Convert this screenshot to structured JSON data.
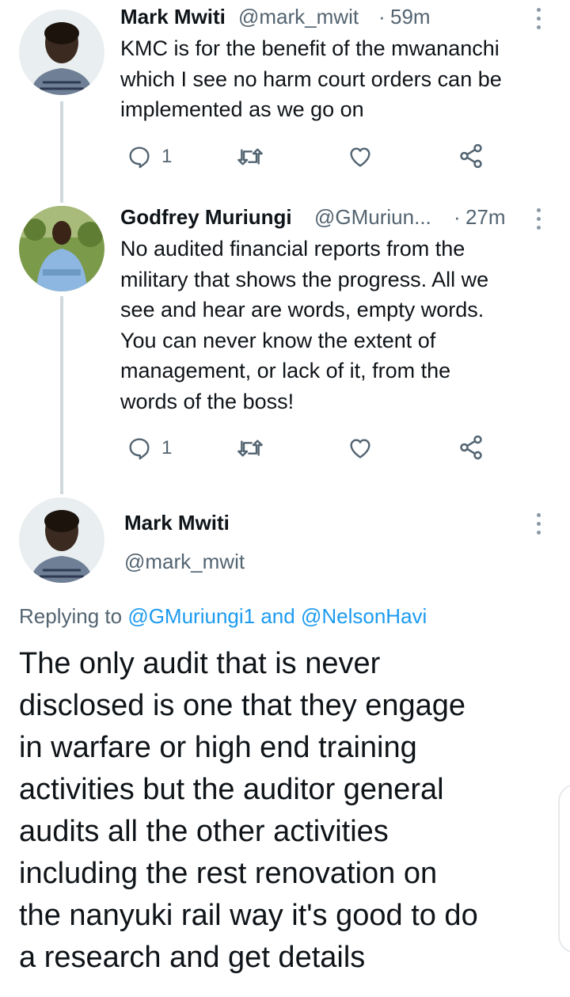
{
  "tweets": [
    {
      "name": "Mark Mwiti",
      "handle": "@mark_mwit",
      "separator": "·",
      "time": "59m",
      "text_lines": [
        "KMC is for the benefit of the mwananchi",
        "which I see no harm court orders can be",
        "implemented as we go on"
      ],
      "reply_count": "1",
      "avatar_icon": "person-avatar-icon"
    },
    {
      "name": "Godfrey Muriungi",
      "handle": "@GMuriun...",
      "separator": "·",
      "time": "27m",
      "text_lines": [
        "No audited financial reports from the",
        "military that shows the progress. All we",
        "see and hear are words, empty words.",
        "You can never know the extent of",
        "management, or lack of it, from the",
        "words of the boss!"
      ],
      "reply_count": "1",
      "avatar_icon": "person-avatar-icon"
    }
  ],
  "focused": {
    "name": "Mark Mwiti",
    "handle": "@mark_mwit",
    "replying_prefix": "Replying to",
    "mention1": "@GMuriungi1",
    "conjunction": "and",
    "mention2": "@NelsonHavi",
    "text_lines": [
      "The only audit that is never",
      "disclosed is one that they engage",
      "in warfare or high end training",
      "activities but the auditor general",
      "audits all the other activities",
      "including the rest renovation on",
      "the nanyuki rail way it's good to do",
      "a research and get details"
    ]
  },
  "colors": {
    "text": "#0f1419",
    "secondary": "#536471",
    "link": "#1d9bf0",
    "thread_line": "#cfd9de"
  }
}
